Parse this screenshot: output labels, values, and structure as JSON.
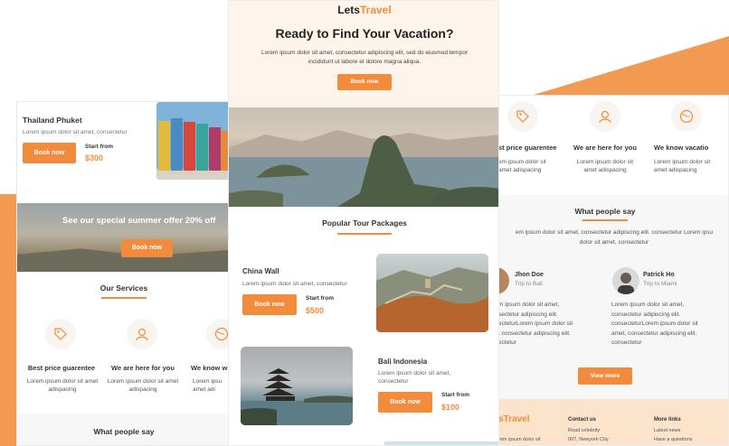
{
  "colors": {
    "accent": "#f28c3c",
    "background": "#ffffff",
    "hero_bg": "#fdf4ec",
    "footer_bg": "#fce3cb"
  },
  "left_email": {
    "tour_card": {
      "title": "Thailand Phuket",
      "desc": "Lorem ipsum dolor sit amet, consectetur",
      "button": "Book now",
      "price_label": "Start from",
      "price": "$300"
    },
    "offer": {
      "text": "See our special summer offer 20% off",
      "button": "Book now"
    },
    "services": {
      "title": "Our Services",
      "items": [
        {
          "icon": "tag-icon",
          "title": "Best price guarentee",
          "desc": "Lorem ipsum dolor sit amet adispacing"
        },
        {
          "icon": "support-agent-icon",
          "title": "We are here for you",
          "desc": "Lorem ipsum dolor sit amet adispacing"
        },
        {
          "icon": "globe-icon",
          "title": "We know w",
          "desc": "Lorem ipsu amet adi"
        }
      ]
    },
    "what_people_say": "What people say"
  },
  "center_email": {
    "logo_part1": "Lets",
    "logo_part2": "Travel",
    "hero": {
      "title": "Ready to Find Your Vacation?",
      "desc_line1": "Lorem ipsum dolor sit amet, consectetur adipiscing elit, sed do eiusmod tempor",
      "desc_line2": "incididunt ut labore et dolore magna aliqua.",
      "button": "Book now"
    },
    "popular_title": "Popular Tour Packages",
    "packages": [
      {
        "title": "China Wall",
        "desc_line1": "Lorem ipsum dolor sit amet, consectetur",
        "desc_line2": "",
        "button": "Book now",
        "price_label": "Start from",
        "price": "$500"
      },
      {
        "title": "Bali Indonesia",
        "desc_line1": "Lorem ipsum dolor sit amet,",
        "desc_line2": "consectetur",
        "button": "Book now",
        "price_label": "Start from",
        "price": "$100"
      }
    ]
  },
  "right_email": {
    "services": [
      {
        "icon": "tag-icon",
        "title": "st price guarentee",
        "desc_line1": "em ipsum dolor sit",
        "desc_line2": "amet adispacing"
      },
      {
        "icon": "support-agent-icon",
        "title": "We are here for you",
        "desc_line1": "Lorem ipsum dolor sit",
        "desc_line2": "amet adispacing"
      },
      {
        "icon": "globe-icon",
        "title": "We know vacatio",
        "desc_line1": "Lorem ipsum dolor sit",
        "desc_line2": "amet adispacing"
      }
    ],
    "what_people_say": {
      "title": "What people say",
      "intro_line1": "em ipsum dolor sit amet, consectetur adipiscing elit. consectetur Lorem ipsu",
      "intro_line2": "dolor sit amet, consectetur"
    },
    "reviews": [
      {
        "name": "Jhon Doe",
        "role": "Trip to Bali",
        "lines": [
          "m ipsum dolor sit amet,",
          "sectetur adipiscing elit.",
          "ecteturLorem ipsum dolor sit",
          ", consectetur adipiscing elit.",
          "ectetur"
        ]
      },
      {
        "name": "Patrick Ho",
        "role": "Trip to Miami",
        "lines": [
          "Lorem ipsum dolor sit amet,",
          "consectetur adipiscing elit.",
          "consecteturLorem ipsum dolor sit",
          "amet, consectetur adipiscing elit.",
          "consectetur"
        ]
      }
    ],
    "view_more": "View more",
    "footer": {
      "logo": "sTravel",
      "logo_sub": "rem ipsum dolor sit",
      "contact_title": "Contact us",
      "contact_items": [
        "Road celebrity",
        "007, Newyork City"
      ],
      "links_title": "More links",
      "link_items": [
        "Latest news",
        "Have a questions"
      ]
    }
  }
}
